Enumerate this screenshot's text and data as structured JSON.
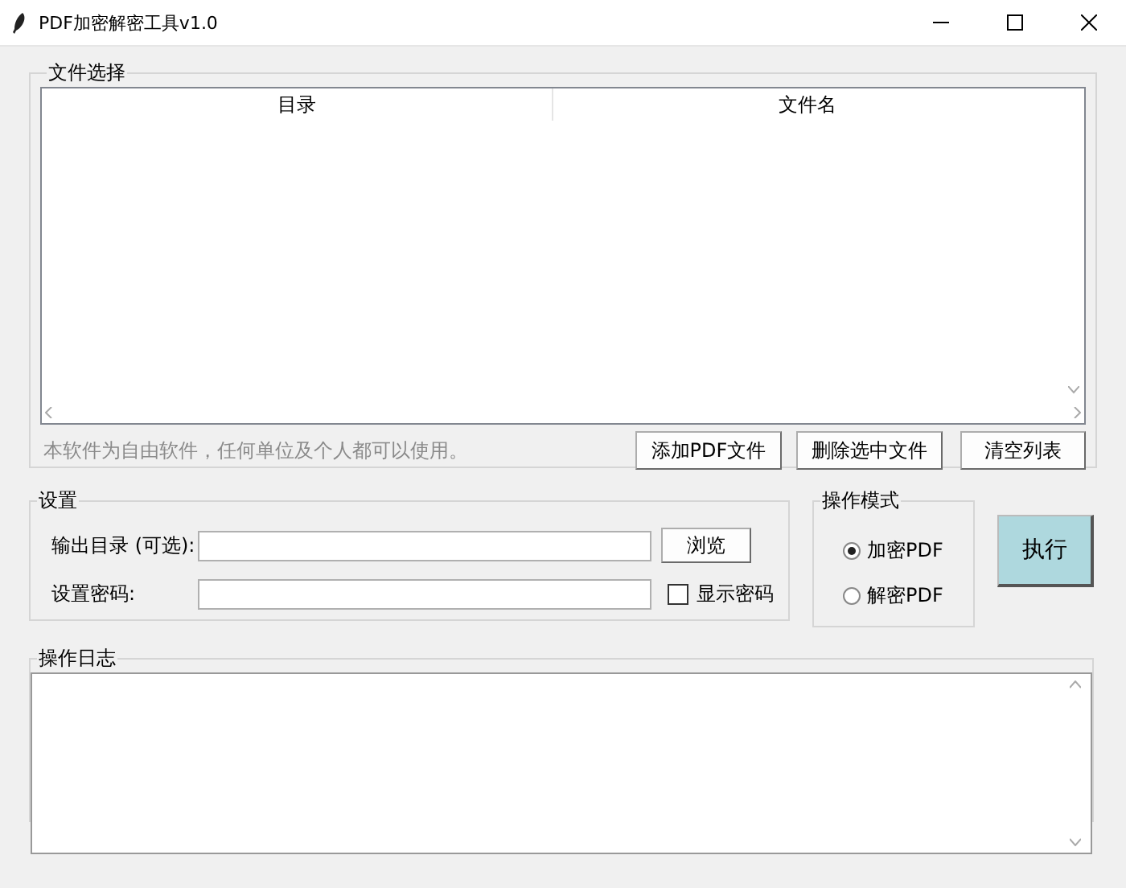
{
  "window": {
    "title": "PDF加密解密工具v1.0"
  },
  "file_section": {
    "title": "文件选择",
    "table": {
      "columns": [
        "目录",
        "文件名"
      ]
    },
    "note": "本软件为自由软件，任何单位及个人都可以使用。",
    "buttons": [
      "添加PDF文件",
      "删除选中文件",
      "清空列表"
    ]
  },
  "settings": {
    "title": "设置",
    "fields": [
      {
        "label": "输出目录 (可选):",
        "button": "浏览"
      },
      {
        "label": "设置密码:",
        "checkbox": {
          "label": "显示密码",
          "checked": false
        }
      }
    ]
  },
  "mode": {
    "title": "操作模式",
    "options": [
      {
        "label": "加密PDF",
        "selected": true
      },
      {
        "label": "解密PDF",
        "selected": false
      }
    ]
  },
  "run_button": "执行",
  "log": {
    "title": "操作日志"
  }
}
